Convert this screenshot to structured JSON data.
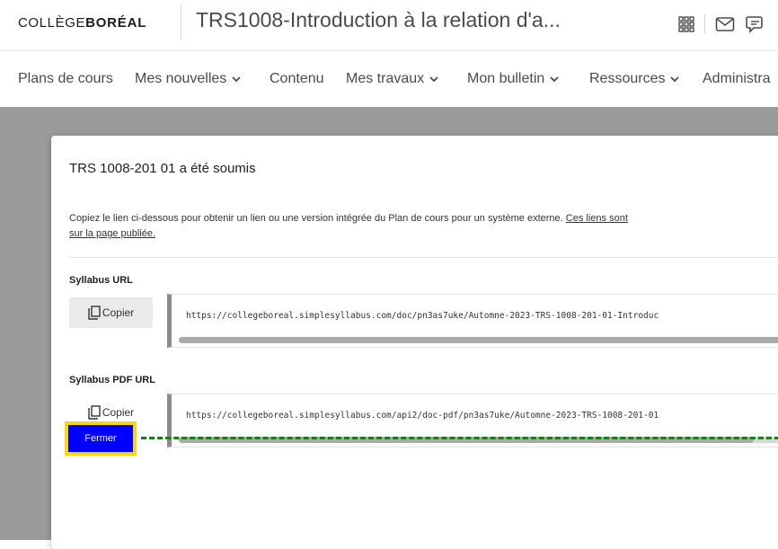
{
  "header": {
    "logo_light": "COLLÈGE",
    "logo_bold": "BORÉAL",
    "course_title": "TRS1008-Introduction à la relation d'a...",
    "icons": [
      "apps-grid-icon",
      "mail-icon",
      "chat-icon",
      "bell-icon"
    ]
  },
  "nav": {
    "items": [
      {
        "label": "Plans de cours",
        "dropdown": false
      },
      {
        "label": "Mes nouvelles",
        "dropdown": true
      },
      {
        "label": "Contenu",
        "dropdown": false
      },
      {
        "label": "Mes travaux",
        "dropdown": true
      },
      {
        "label": "Mon bulletin",
        "dropdown": true
      },
      {
        "label": "Ressources",
        "dropdown": true
      },
      {
        "label": "Administra",
        "dropdown": false
      }
    ]
  },
  "dialog": {
    "title": "TRS 1008-201 01 a été soumis",
    "description": "Copiez le lien ci-dessous pour obtenir un lien ou une version intégrée du Plan de cours pour un système externe.",
    "description_link": "Ces liens sont",
    "description_link2": "sur la page publiée.",
    "syllabus_url": {
      "label": "Syllabus URL",
      "copy_label": "Copier",
      "value": "https://collegeboreal.simplesyllabus.com/doc/pn3as7uke/Automne-2023-TRS-1008-201-01-Introduc"
    },
    "syllabus_pdf_url": {
      "label": "Syllabus PDF URL",
      "copy_label": "Copier",
      "value": "https://collegeboreal.simplesyllabus.com/api2/doc-pdf/pn3as7uke/Automne-2023-TRS-1008-201-01"
    },
    "close_label": "Fermer"
  },
  "colors": {
    "overlay": "#9b9b9b",
    "close_button": "#0000ff",
    "highlight": "#f7d70f",
    "annotation_line": "#1f7a1f"
  }
}
